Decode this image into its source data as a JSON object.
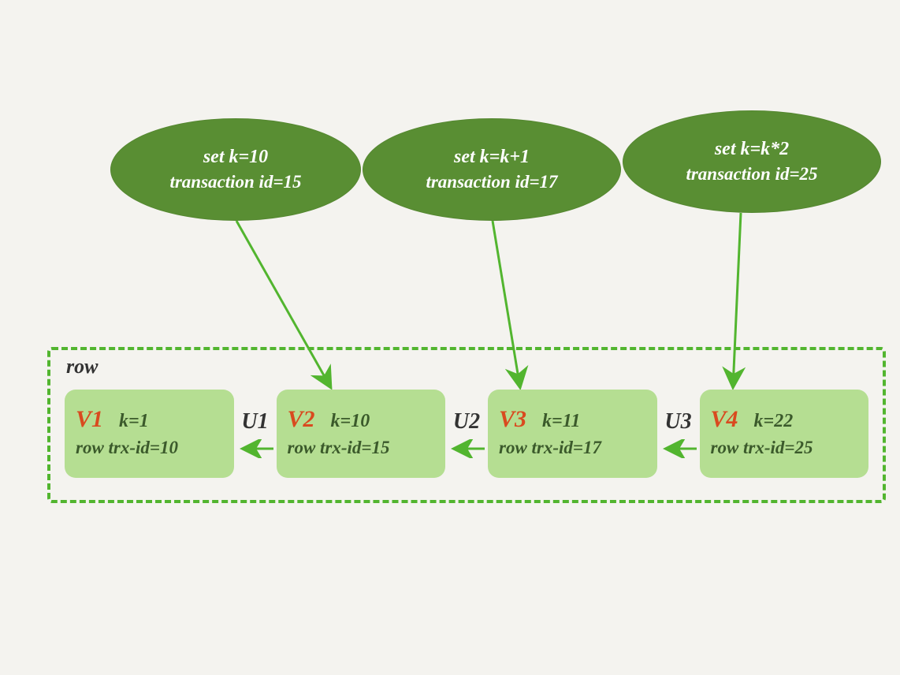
{
  "transactions": [
    {
      "op": "set k=10",
      "txid": "transaction id=15"
    },
    {
      "op": "set k=k+1",
      "txid": "transaction id=17"
    },
    {
      "op": "set k=k*2",
      "txid": "transaction id=25"
    }
  ],
  "row_label": "row",
  "versions": [
    {
      "name": "V1",
      "k": "k=1",
      "trx": "row trx-id=10"
    },
    {
      "name": "V2",
      "k": "k=10",
      "trx": "row trx-id=15"
    },
    {
      "name": "V3",
      "k": "k=11",
      "trx": "row trx-id=17"
    },
    {
      "name": "V4",
      "k": "k=22",
      "trx": "row trx-id=25"
    }
  ],
  "undo_labels": [
    "U1",
    "U2",
    "U3"
  ]
}
